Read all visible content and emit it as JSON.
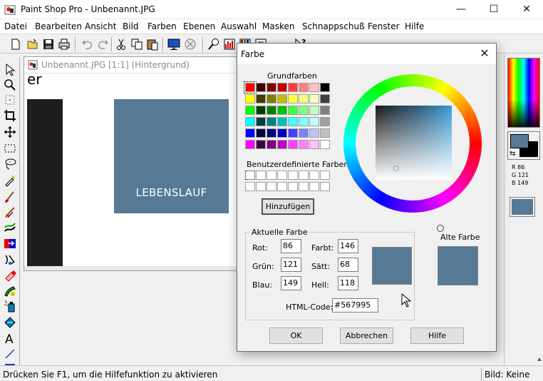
{
  "app": {
    "title": "Paint Shop Pro - Unbenannt.JPG",
    "window_controls": {
      "minimize": "—",
      "maximize": "☐",
      "close": "✕"
    }
  },
  "menu": [
    "Datei",
    "Bearbeiten",
    "Ansicht",
    "Bild",
    "Farben",
    "Ebenen",
    "Auswahl",
    "Masken",
    "Schnappschuß",
    "Fenster",
    "Hilfe"
  ],
  "toolbar_icons": [
    "new-icon",
    "open-icon",
    "save-icon",
    "print-icon",
    "undo-icon",
    "redo-icon",
    "cut-icon",
    "copy-icon",
    "paste-icon",
    "full-screen-icon",
    "browse-icon",
    "zoom-icon",
    "histogram-icon",
    "layers-icon",
    "overview-icon",
    "context-help-icon"
  ],
  "tool_icons": [
    "arrow-icon",
    "zoom-tool-icon",
    "deform-icon",
    "crop-icon",
    "mover-icon",
    "selection-icon",
    "lasso-icon",
    "dropper-icon",
    "paintbrush-icon",
    "clone-brush-icon",
    "color-replacer-icon",
    "retouch-icon",
    "scratch-remover-icon",
    "eraser-icon",
    "picture-tube-icon",
    "airbrush-icon",
    "flood-fill-icon",
    "text-tool-icon",
    "line-tool-icon",
    "shape-tool-icon"
  ],
  "image_window": {
    "title": "Unbenannt.JPG [1:1] (Hintergrund)",
    "canvas_text_top": "er",
    "canvas_box_text": "LEBENSLAUF",
    "box_color": "#567995"
  },
  "right_panel": {
    "r_label": "R  86",
    "g_label": "G  121",
    "b_label": "B  149",
    "fg_color": "#567995",
    "bg_color": "#000000"
  },
  "status": {
    "left": "Drücken Sie F1, um die Hilfefunktion zu aktivieren",
    "right": "Bild: Keine"
  },
  "dialog": {
    "title": "Farbe",
    "basic_colors_label": "Grundfarben",
    "custom_colors_label": "Benutzerdefinierte Farben",
    "add_button": "Hinzufügen",
    "current_color_group": "Aktuelle Farbe",
    "old_color_label": "Alte Farbe",
    "fields": {
      "red_label": "Rot:",
      "red": "86",
      "green_label": "Grün:",
      "green": "121",
      "blue_label": "Blau:",
      "blue": "149",
      "hue_label": "Farbt:",
      "hue": "146",
      "sat_label": "Sätt:",
      "sat": "68",
      "light_label": "Hell:",
      "light": "118",
      "html_label": "HTML-Code:",
      "html": "#567995"
    },
    "buttons": {
      "ok": "OK",
      "cancel": "Abbrechen",
      "help": "Hilfe"
    },
    "current_color": "#567995",
    "old_color": "#567995",
    "basic_colors": [
      [
        "#ff0000",
        "#400000",
        "#800000",
        "#c00000",
        "#ff4040",
        "#ff8080",
        "#ffc0c0",
        "#000000"
      ],
      [
        "#ffff00",
        "#404000",
        "#808000",
        "#c0c000",
        "#ffff40",
        "#ffff80",
        "#ffffc0",
        "#404040"
      ],
      [
        "#00ff00",
        "#004000",
        "#008000",
        "#00c000",
        "#40ff40",
        "#80ff80",
        "#c0ffc0",
        "#808080"
      ],
      [
        "#00ffff",
        "#004040",
        "#008080",
        "#00c0c0",
        "#40ffff",
        "#80ffff",
        "#c0ffff",
        "#a0a0a0"
      ],
      [
        "#0000ff",
        "#000040",
        "#000080",
        "#0000c0",
        "#4040ff",
        "#8080ff",
        "#c0c0ff",
        "#c0c0c0"
      ],
      [
        "#ff00ff",
        "#400040",
        "#800080",
        "#c000c0",
        "#ff40ff",
        "#ff80ff",
        "#ffc0ff",
        "#ffffff"
      ]
    ],
    "custom_colors": [
      [
        "#ffffff",
        "#ffffff",
        "#ffffff",
        "#ffffff",
        "#ffffff",
        "#ffffff",
        "#ffffff",
        "#ffffff"
      ],
      [
        "#ffffff",
        "#ffffff",
        "#ffffff",
        "#ffffff",
        "#ffffff",
        "#ffffff",
        "#ffffff",
        "#ffffff"
      ]
    ]
  }
}
